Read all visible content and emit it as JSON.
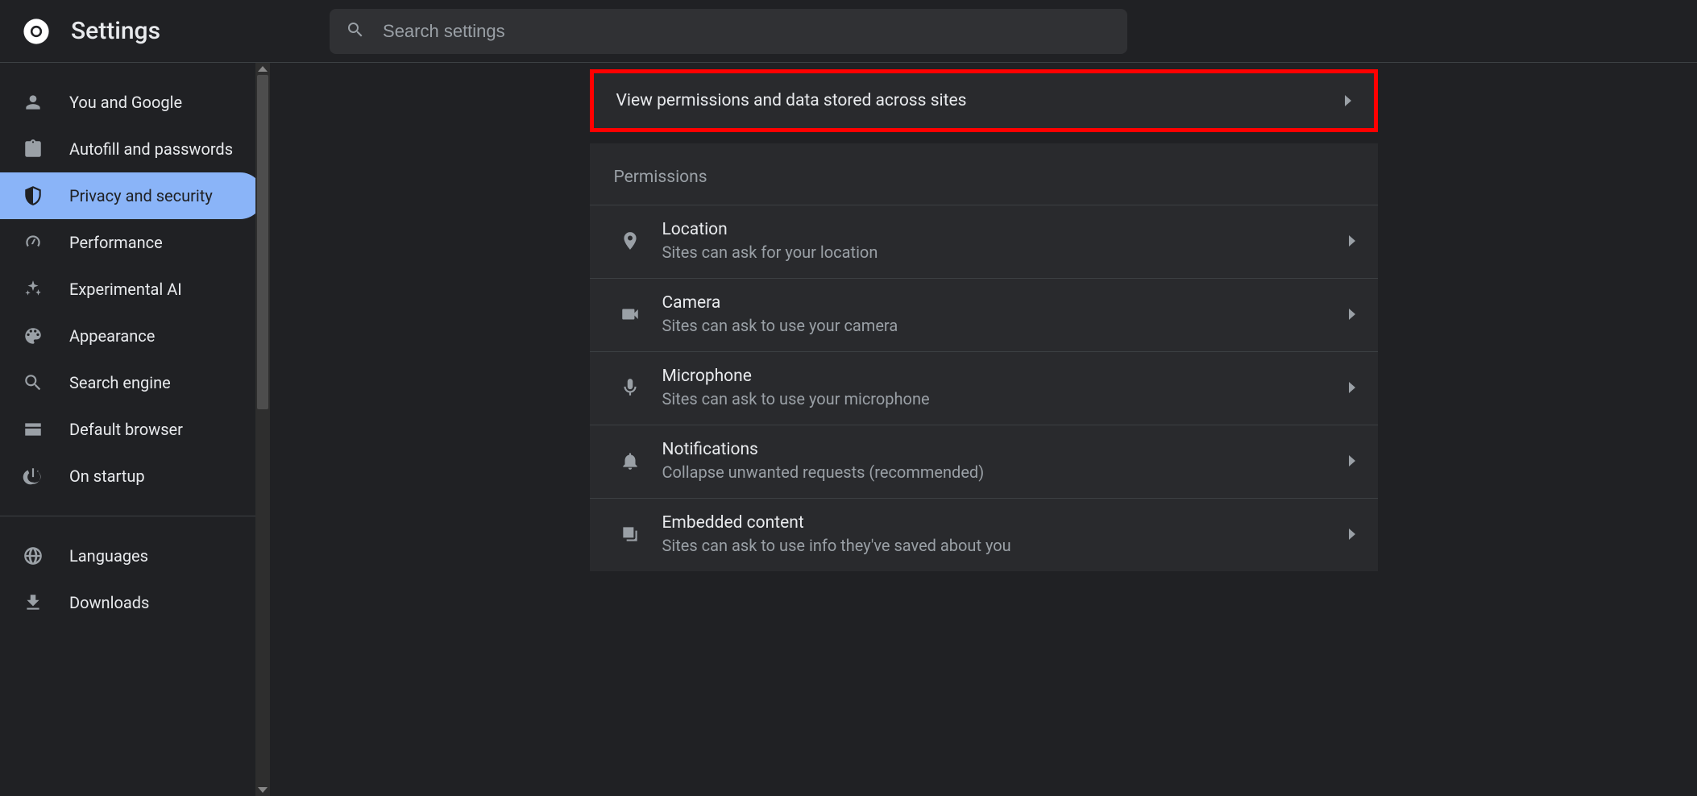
{
  "header": {
    "title": "Settings",
    "search_placeholder": "Search settings"
  },
  "sidebar": {
    "items": [
      {
        "label": "You and Google",
        "icon": "person-icon"
      },
      {
        "label": "Autofill and passwords",
        "icon": "clipboard-icon"
      },
      {
        "label": "Privacy and security",
        "icon": "shield-icon",
        "active": true
      },
      {
        "label": "Performance",
        "icon": "speedometer-icon"
      },
      {
        "label": "Experimental AI",
        "icon": "sparkle-icon"
      },
      {
        "label": "Appearance",
        "icon": "palette-icon"
      },
      {
        "label": "Search engine",
        "icon": "search-icon"
      },
      {
        "label": "Default browser",
        "icon": "window-icon"
      },
      {
        "label": "On startup",
        "icon": "power-icon"
      }
    ],
    "items2": [
      {
        "label": "Languages",
        "icon": "globe-icon"
      },
      {
        "label": "Downloads",
        "icon": "download-icon"
      }
    ]
  },
  "main": {
    "top_row": {
      "label": "View permissions and data stored across sites"
    },
    "permissions_heading": "Permissions",
    "permissions": [
      {
        "title": "Location",
        "sub": "Sites can ask for your location",
        "icon": "pin-icon"
      },
      {
        "title": "Camera",
        "sub": "Sites can ask to use your camera",
        "icon": "camera-icon"
      },
      {
        "title": "Microphone",
        "sub": "Sites can ask to use your microphone",
        "icon": "mic-icon"
      },
      {
        "title": "Notifications",
        "sub": "Collapse unwanted requests (recommended)",
        "icon": "bell-icon"
      },
      {
        "title": "Embedded content",
        "sub": "Sites can ask to use info they've saved about you",
        "icon": "embed-icon"
      }
    ]
  }
}
